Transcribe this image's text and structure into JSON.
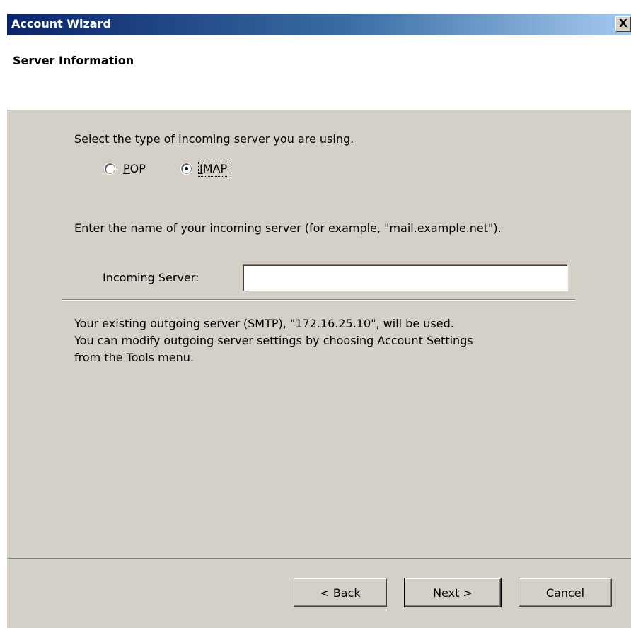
{
  "window": {
    "title": "Account Wizard",
    "close_label": "X"
  },
  "header": {
    "title": "Server Information"
  },
  "server_type": {
    "prompt": "Select the type of incoming server you are using.",
    "options": [
      {
        "label": "POP",
        "selected": false
      },
      {
        "label": "IMAP",
        "selected": true
      }
    ]
  },
  "incoming_server": {
    "prompt": "Enter the name of your incoming server (for example, \"mail.example.net\").",
    "label": "Incoming Server:",
    "value": ""
  },
  "outgoing_info": {
    "line1": "Your existing outgoing server (SMTP), \"172.16.25.10\", will be used.",
    "line2": "You can modify outgoing server settings by choosing Account Settings",
    "line3": "from the Tools menu."
  },
  "buttons": {
    "back": "< Back",
    "next": "Next >",
    "cancel": "Cancel"
  }
}
